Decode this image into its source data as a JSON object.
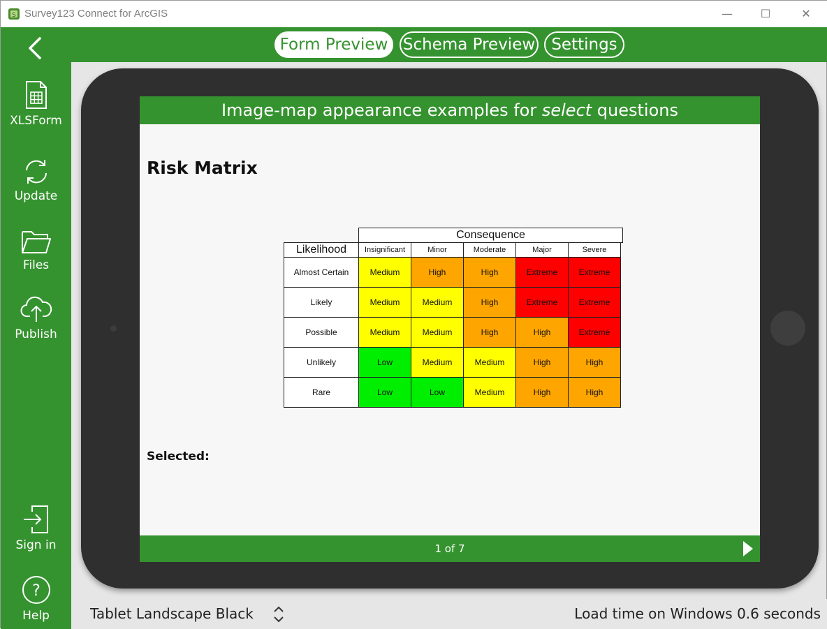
{
  "window": {
    "title": "Survey123 Connect for ArcGIS",
    "minimize": "—",
    "maximize": "☐",
    "close": "✕"
  },
  "tabs": {
    "form_preview": "Form Preview",
    "schema_preview": "Schema Preview",
    "settings": "Settings",
    "active": "Form Preview"
  },
  "sidebar": {
    "xlsform": "XLSForm",
    "update": "Update",
    "files": "Files",
    "publish": "Publish",
    "sign_in": "Sign in",
    "help": "Help"
  },
  "form": {
    "header_pre": "Image-map appearance examples for ",
    "header_em": "select",
    "header_post": " questions",
    "question_title": "Risk Matrix",
    "selected_label": "Selected:",
    "page_indicator": "1 of 7"
  },
  "matrix": {
    "consequence_label": "Consequence",
    "likelihood_label": "Likelihood",
    "columns": [
      "Insignificant",
      "Minor",
      "Moderate",
      "Major",
      "Severe"
    ],
    "rows": [
      {
        "label": "Almost Certain",
        "cells": [
          "Medium",
          "High",
          "High",
          "Extreme",
          "Extreme"
        ]
      },
      {
        "label": "Likely",
        "cells": [
          "Medium",
          "Medium",
          "High",
          "Extreme",
          "Extreme"
        ]
      },
      {
        "label": "Possible",
        "cells": [
          "Medium",
          "Medium",
          "High",
          "High",
          "Extreme"
        ]
      },
      {
        "label": "Unlikely",
        "cells": [
          "Low",
          "Medium",
          "Medium",
          "High",
          "High"
        ]
      },
      {
        "label": "Rare",
        "cells": [
          "Low",
          "Low",
          "Medium",
          "High",
          "High"
        ]
      }
    ],
    "colors": {
      "Low": "#00ee00",
      "Medium": "#ffff00",
      "High": "#ffa500",
      "Extreme": "#ff0000"
    }
  },
  "bottom": {
    "device": "Tablet Landscape Black",
    "load_time": "Load time on Windows 0.6 seconds"
  },
  "colors": {
    "brand_green": "#35932f",
    "device_body": "#2f2f2f"
  }
}
